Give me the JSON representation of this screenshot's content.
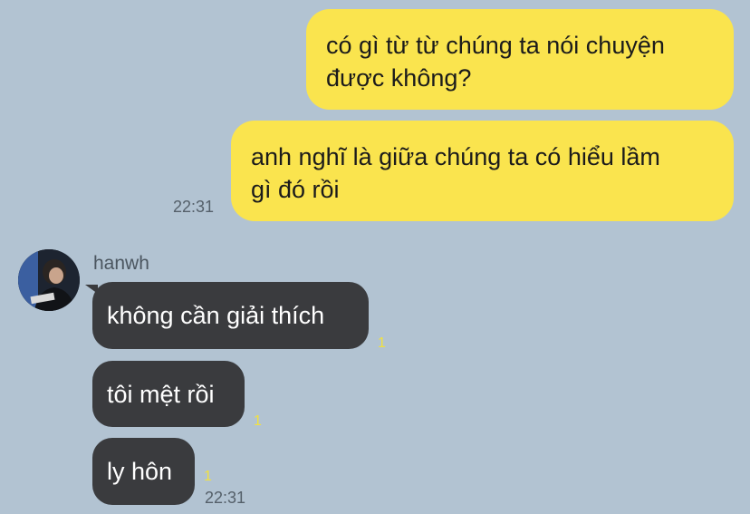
{
  "outgoing": {
    "messages": [
      {
        "text": "có gì từ từ chúng ta nói chuyện\nđược không?"
      },
      {
        "text": "anh nghĩ là giữa chúng ta có hiểu lầm\ngì đó rồi"
      }
    ],
    "time": "22:31"
  },
  "incoming": {
    "sender": "hanwh",
    "messages": [
      {
        "text": "không cần giải thích",
        "unread": "1"
      },
      {
        "text": "tôi mệt rồi",
        "unread": "1"
      },
      {
        "text": "ly hôn",
        "unread": "1"
      }
    ],
    "time": "22:31"
  },
  "colors": {
    "background": "#b2c3d2",
    "outgoing_bubble": "#fae44e",
    "incoming_bubble": "#3a3b3e",
    "unread_count": "#f2e13f"
  }
}
